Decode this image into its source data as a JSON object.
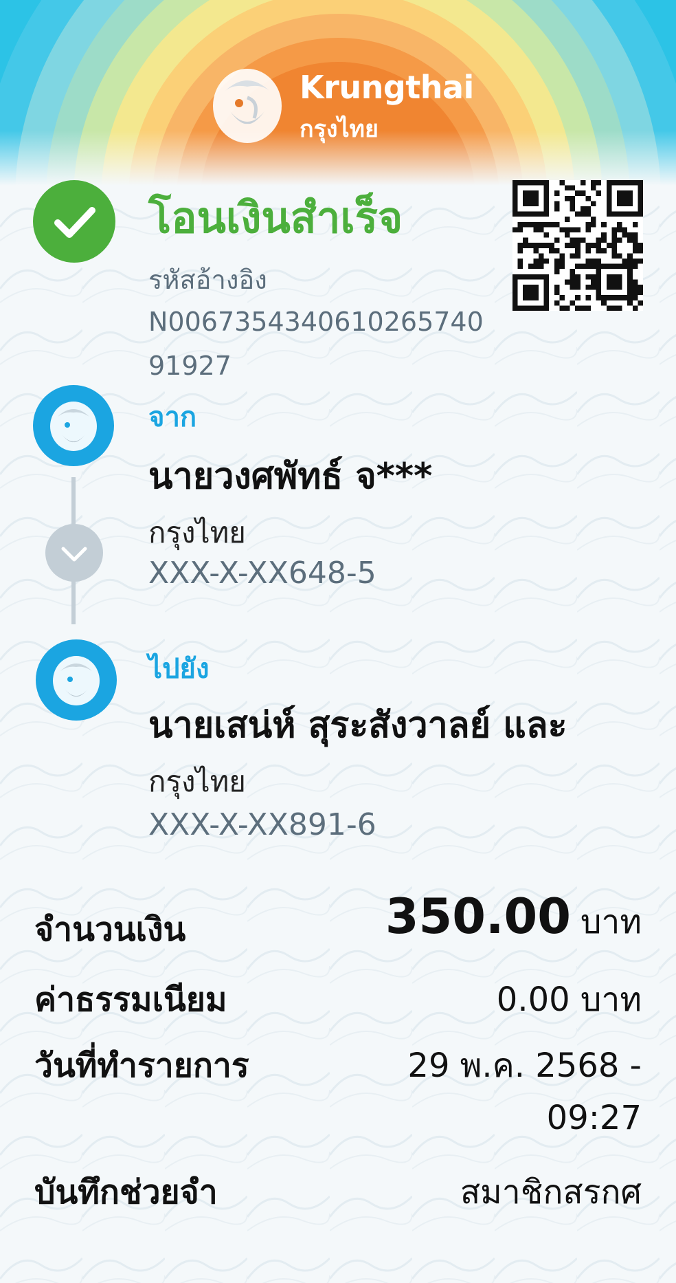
{
  "brand": {
    "name_en": "Krungthai",
    "name_th": "กรุงไทย"
  },
  "status": {
    "title": "โอนเงินสำเร็จ",
    "ref_label": "รหัสอ้างอิง",
    "ref_value": "N006735434061026574091927"
  },
  "from": {
    "label": "จาก",
    "name": "นายวงศพัทธ์ จ***",
    "bank": "กรุงไทย",
    "account": "XXX-X-XX648-5"
  },
  "to": {
    "label": "ไปยัง",
    "name": "นายเสน่ห์ สุระสังวาลย์ และ",
    "bank": "กรุงไทย",
    "account": "XXX-X-XX891-6"
  },
  "details": {
    "amount_label": "จำนวนเงิน",
    "amount_value": "350.00",
    "amount_unit": "บาท",
    "fee_label": "ค่าธรรมเนียม",
    "fee_value": "0.00 บาท",
    "date_label": "วันที่ทำรายการ",
    "date_value_line1": "29 พ.ค. 2568 -",
    "date_value_line2": "09:27",
    "memo_label": "บันทึกช่วยจำ",
    "memo_value": "สมาชิกสรกศ"
  },
  "icons": {
    "status": "check-icon",
    "qr": "qr-code-icon",
    "bank_logo": "krungthai-bird-icon",
    "connector": "chevron-down-icon"
  },
  "colors": {
    "success": "#4caf3c",
    "accent": "#1ba5e1",
    "muted": "#5c6e7c",
    "connector": "#c3ced6"
  }
}
